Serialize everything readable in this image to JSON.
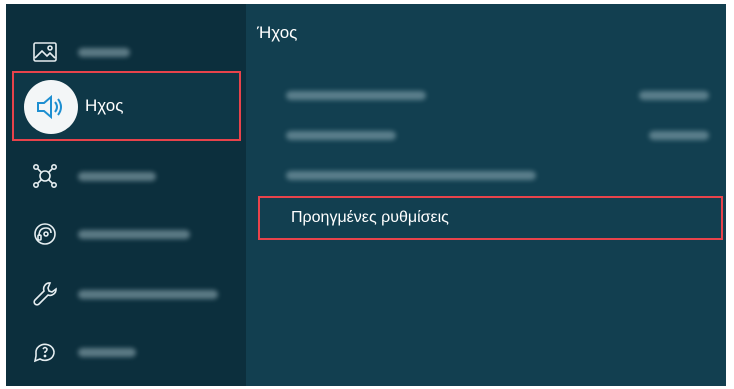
{
  "sidebar": {
    "items": [
      {
        "icon": "picture-icon",
        "label": "",
        "active": false
      },
      {
        "icon": "sound-icon",
        "label": "Ηχος",
        "active": true
      },
      {
        "icon": "connection-icon",
        "label": "",
        "active": false
      },
      {
        "icon": "support-headset-icon",
        "label": "",
        "active": false
      },
      {
        "icon": "wrench-icon",
        "label": "",
        "active": false
      },
      {
        "icon": "help-chat-icon",
        "label": "",
        "active": false
      }
    ]
  },
  "main": {
    "title": "Ήχος",
    "rows": [
      {
        "label": "",
        "value": ""
      },
      {
        "label": "",
        "value": ""
      },
      {
        "label": "",
        "value": ""
      },
      {
        "label": "Προηγμένες ρυθμίσεις",
        "value": "",
        "selected": true
      }
    ]
  },
  "colors": {
    "background": "#0f3a4a",
    "sidebar": "#0c2f3d",
    "highlight_border": "#e8434b",
    "text": "#ffffff"
  }
}
